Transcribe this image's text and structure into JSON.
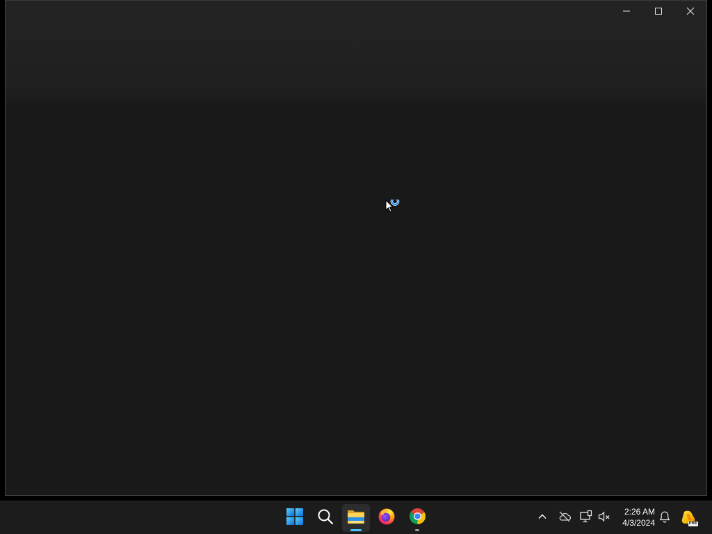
{
  "colors": {
    "desktop": "#000000",
    "window_header": "#202020",
    "window_body": "#191919",
    "taskbar": "#1c1c1c",
    "accent": "#4cc2ff",
    "spinner": "#1e90ff"
  },
  "window": {
    "controls": {
      "minimize_icon": "minimize-icon",
      "maximize_icon": "maximize-icon",
      "close_icon": "close-icon"
    }
  },
  "cursor": {
    "icon": "busy-cursor-icon"
  },
  "taskbar": {
    "pinned": [
      {
        "icon": "windows-start-icon",
        "active": false,
        "running": false
      },
      {
        "icon": "search-icon",
        "active": false,
        "running": false
      },
      {
        "icon": "file-explorer-icon",
        "active": true,
        "running": true
      },
      {
        "icon": "firefox-icon",
        "active": false,
        "running": false
      },
      {
        "icon": "chrome-icon",
        "active": false,
        "running": true
      }
    ],
    "tray": {
      "icons": [
        "chevron-up-icon",
        "cloud-off-icon",
        "network-icon",
        "volume-muted-icon",
        "bell-icon",
        "pre-app-icon"
      ],
      "pre_badge": "PRE"
    },
    "clock": {
      "time": "2:26 AM",
      "date": "4/3/2024"
    }
  }
}
